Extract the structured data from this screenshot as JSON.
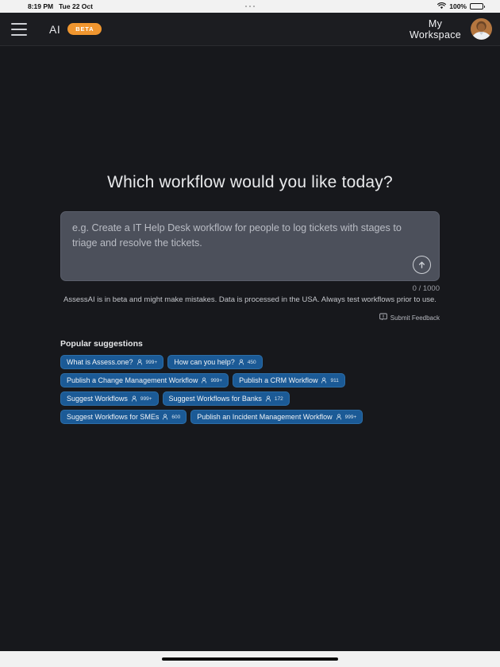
{
  "statusbar": {
    "time": "8:19 PM",
    "date": "Tue 22 Oct",
    "battery_percent": "100%",
    "wifi_icon": "wifi-icon",
    "battery_icon": "battery-icon",
    "multitask_icon": "multitask-dots-icon"
  },
  "topnav": {
    "menu_icon": "hamburger-menu-icon",
    "brand": "AI",
    "beta_badge": "BETA",
    "workspace_line1": "My",
    "workspace_line2": "Workspace",
    "avatar_icon": "user-avatar",
    "beta_color": "#f0962f"
  },
  "main": {
    "headline": "Which workflow would you like today?",
    "prompt": {
      "value": "",
      "placeholder": "e.g. Create a IT Help Desk workflow for people to log tickets with stages to triage and resolve the tickets.",
      "send_icon": "arrow-up-circle-icon",
      "counter": "0 / 1000"
    },
    "disclaimer": "AssessAI is in beta and might make mistakes. Data is processed in the USA. Always test workflows prior to use.",
    "feedback": {
      "label": "Submit Feedback",
      "icon": "feedback-message-icon"
    },
    "suggestions": {
      "title": "Popular suggestions",
      "items": [
        {
          "label": "What is Assess.one?",
          "count": "999+",
          "icon": "person-icon"
        },
        {
          "label": "How can you help?",
          "count": "450",
          "icon": "person-icon"
        },
        {
          "label": "Publish a Change Management Workflow",
          "count": "999+",
          "icon": "person-icon"
        },
        {
          "label": "Publish a CRM Workflow",
          "count": "911",
          "icon": "person-icon"
        },
        {
          "label": "Suggest Workflows",
          "count": "999+",
          "icon": "person-icon"
        },
        {
          "label": "Suggest Workflows for Banks",
          "count": "172",
          "icon": "person-icon"
        },
        {
          "label": "Suggest Workflows for SMEs",
          "count": "600",
          "icon": "person-icon"
        },
        {
          "label": "Publish an Incident Management Workflow",
          "count": "999+",
          "icon": "person-icon"
        }
      ]
    }
  },
  "colors": {
    "app_background": "#17181c",
    "nav_background": "#1c1d21",
    "chip_blue": "#1b5a96",
    "prompt_background": "#4c505b"
  }
}
